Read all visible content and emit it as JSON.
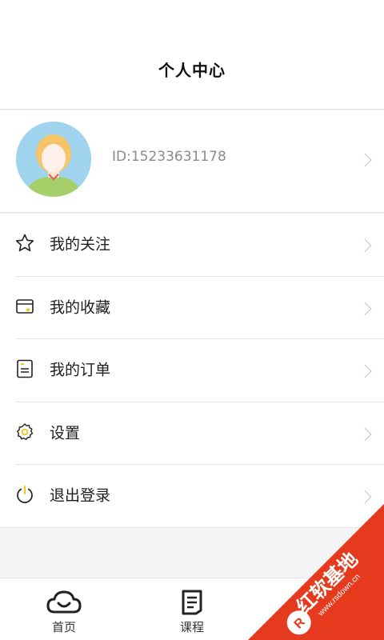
{
  "header": {
    "title": "个人中心"
  },
  "profile": {
    "user_id": "ID:15233631178",
    "avatar_icon": "avatar-icon"
  },
  "menu": {
    "items": [
      {
        "label": "我的关注",
        "icon": "star-icon"
      },
      {
        "label": "我的收藏",
        "icon": "favorites-icon"
      },
      {
        "label": "我的订单",
        "icon": "orders-icon"
      },
      {
        "label": "设置",
        "icon": "settings-icon"
      },
      {
        "label": "退出登录",
        "icon": "power-icon"
      }
    ]
  },
  "tabbar": {
    "tabs": [
      {
        "label": "首页",
        "icon": "home-cloud-icon"
      },
      {
        "label": "课程",
        "icon": "course-document-icon"
      }
    ]
  },
  "watermark": {
    "brand": "红软基地",
    "domain": "www.rsdown.cn"
  },
  "colors": {
    "accent": "#e63a1e",
    "icon_yellow": "#f5c518",
    "avatar_bg": "#9fd3ee"
  }
}
